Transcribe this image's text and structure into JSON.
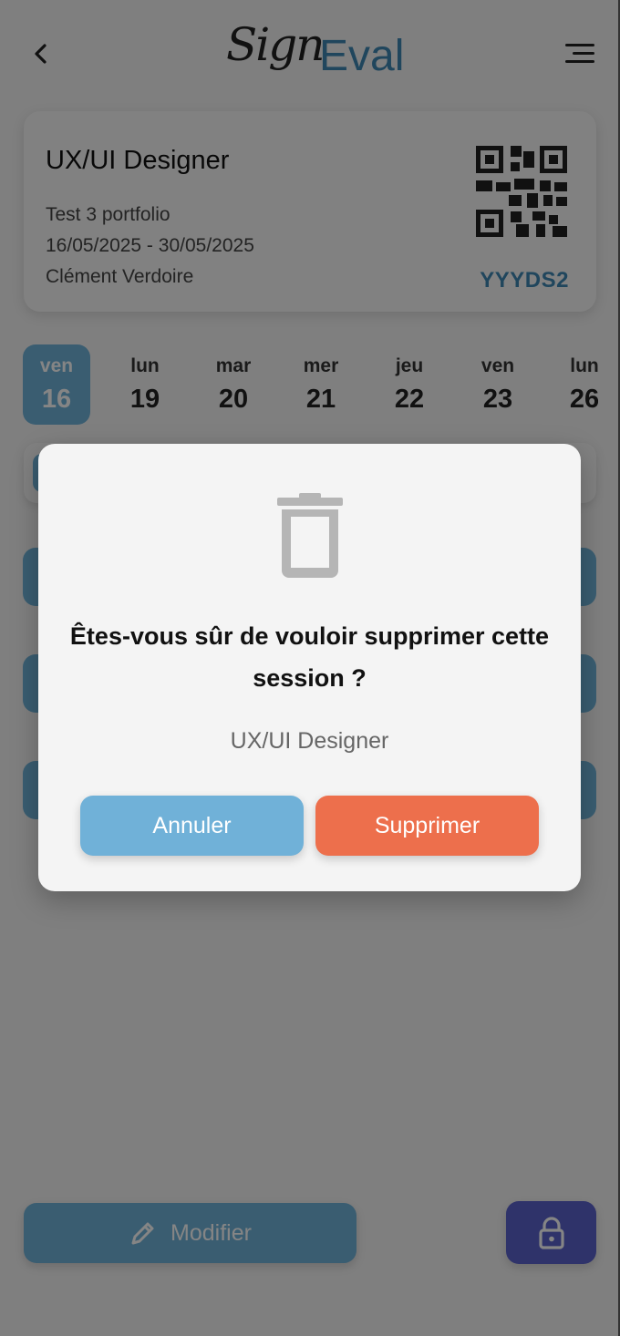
{
  "header": {
    "logo_script": "Sign",
    "logo_text": "Eval",
    "back_icon": "chevron-left-icon",
    "menu_icon": "menu-icon"
  },
  "session": {
    "title": "UX/UI Designer",
    "description": "Test 3 portfolio",
    "dates": "16/05/2025 - 30/05/2025",
    "trainer": "Clément Verdoire",
    "code": "YYYDS2"
  },
  "days": [
    {
      "name": "ven",
      "num": "16"
    },
    {
      "name": "lun",
      "num": "19"
    },
    {
      "name": "mar",
      "num": "20"
    },
    {
      "name": "mer",
      "num": "21"
    },
    {
      "name": "jeu",
      "num": "22"
    },
    {
      "name": "ven",
      "num": "23"
    },
    {
      "name": "lun",
      "num": "26"
    }
  ],
  "footer": {
    "modify_label": "Modifier",
    "lock_icon": "lock-icon"
  },
  "modal": {
    "icon": "trash-icon",
    "title": "Êtes-vous sûr de vouloir supprimer cette session ?",
    "subtitle": "UX/UI Designer",
    "cancel_label": "Annuler",
    "delete_label": "Supprimer"
  },
  "colors": {
    "accent_blue": "#70b1d8",
    "brand_blue": "#3f86b3",
    "danger": "#ed6f4c",
    "lock_button": "#5a63cc",
    "overlay": "rgba(0,0,0,0.48)"
  }
}
